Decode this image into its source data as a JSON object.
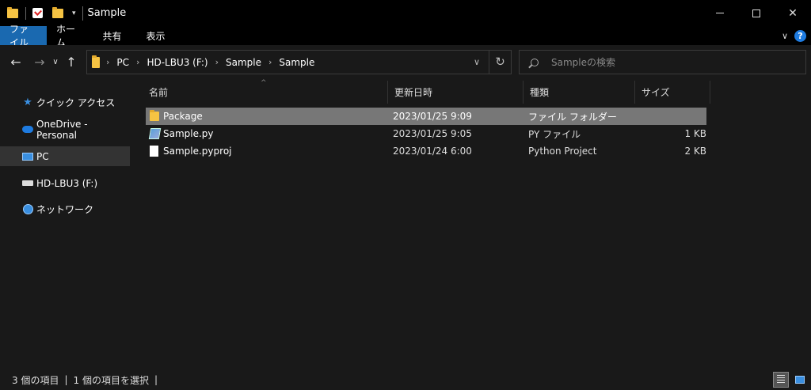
{
  "window": {
    "title": "Sample",
    "controls": {
      "minimize": "minimize",
      "maximize": "maximize",
      "close": "✕"
    }
  },
  "ribbon": {
    "tabs": [
      {
        "label": "ファイル"
      },
      {
        "label": "ホーム"
      },
      {
        "label": "共有"
      },
      {
        "label": "表示"
      }
    ],
    "help_label": "?"
  },
  "navigation": {
    "back": "←",
    "forward": "→",
    "recent": "∨",
    "up": "↑"
  },
  "address": {
    "breadcrumbs": [
      "PC",
      "HD-LBU3 (F:)",
      "Sample",
      "Sample"
    ],
    "dropdown": "∨",
    "refresh": "↻"
  },
  "search": {
    "placeholder": "Sampleの検索"
  },
  "sidebar": {
    "items": [
      {
        "label": "クイック アクセス",
        "icon": "star-icon"
      },
      {
        "label": "OneDrive - Personal",
        "icon": "cloud-icon"
      },
      {
        "label": "PC",
        "icon": "pc-icon",
        "selected": true
      },
      {
        "label": "HD-LBU3 (F:)",
        "icon": "drive-icon"
      },
      {
        "label": "ネットワーク",
        "icon": "network-icon"
      }
    ]
  },
  "file_list": {
    "columns": [
      "名前",
      "更新日時",
      "種類",
      "サイズ"
    ],
    "rows": [
      {
        "name": "Package",
        "modified": "2023/01/25 9:09",
        "type": "ファイル フォルダー",
        "size": "",
        "icon": "folder-icon",
        "selected": true
      },
      {
        "name": "Sample.py",
        "modified": "2023/01/25 9:05",
        "type": "PY ファイル",
        "size": "1 KB",
        "icon": "python-file-icon"
      },
      {
        "name": "Sample.pyproj",
        "modified": "2023/01/24 6:00",
        "type": "Python Project",
        "size": "2 KB",
        "icon": "document-icon"
      }
    ]
  },
  "status": {
    "item_count": "3 個の項目",
    "selection": "1 個の項目を選択",
    "separator": "|"
  },
  "colors": {
    "accent": "#1a69b0",
    "background": "#191919",
    "selected_row": "#777777"
  }
}
